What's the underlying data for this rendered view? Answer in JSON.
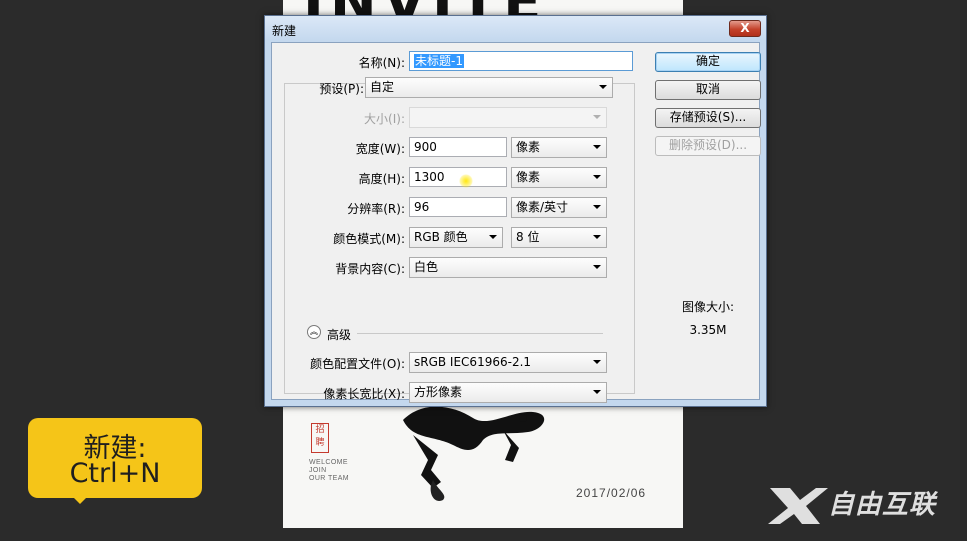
{
  "document": {
    "title_text": "INVITE",
    "stamp_text": "招聘",
    "welcome_text": "WELCOME\nJOIN\nOUR TEAM",
    "date": "2017/02/06"
  },
  "dialog": {
    "title": "新建",
    "close_symbol": "X",
    "name": {
      "label": "名称(N):",
      "value": "未标题-1"
    },
    "preset": {
      "label": "预设(P):",
      "value": "自定"
    },
    "size": {
      "label": "大小(I):",
      "value": ""
    },
    "width": {
      "label": "宽度(W):",
      "value": "900",
      "unit": "像素"
    },
    "height": {
      "label": "高度(H):",
      "value": "1300",
      "unit": "像素"
    },
    "resolution": {
      "label": "分辨率(R):",
      "value": "96",
      "unit": "像素/英寸"
    },
    "color_mode": {
      "label": "颜色模式(M):",
      "value": "RGB 颜色",
      "depth": "8 位"
    },
    "background": {
      "label": "背景内容(C):",
      "value": "白色"
    },
    "advanced": {
      "label": "高级",
      "icon": "collapse-up-icon"
    },
    "color_profile": {
      "label": "颜色配置文件(O):",
      "value": "sRGB IEC61966-2.1"
    },
    "pixel_aspect": {
      "label": "像素长宽比(X):",
      "value": "方形像素"
    },
    "buttons": {
      "ok": "确定",
      "cancel": "取消",
      "save_preset": "存储预设(S)...",
      "delete_preset": "删除预设(D)..."
    },
    "image_size": {
      "label": "图像大小:",
      "value": "3.35M"
    }
  },
  "shortcut": {
    "line1": "新建:",
    "line2": "Ctrl+N",
    "color": "#f5c518"
  },
  "watermark": {
    "text": "自由互联"
  }
}
